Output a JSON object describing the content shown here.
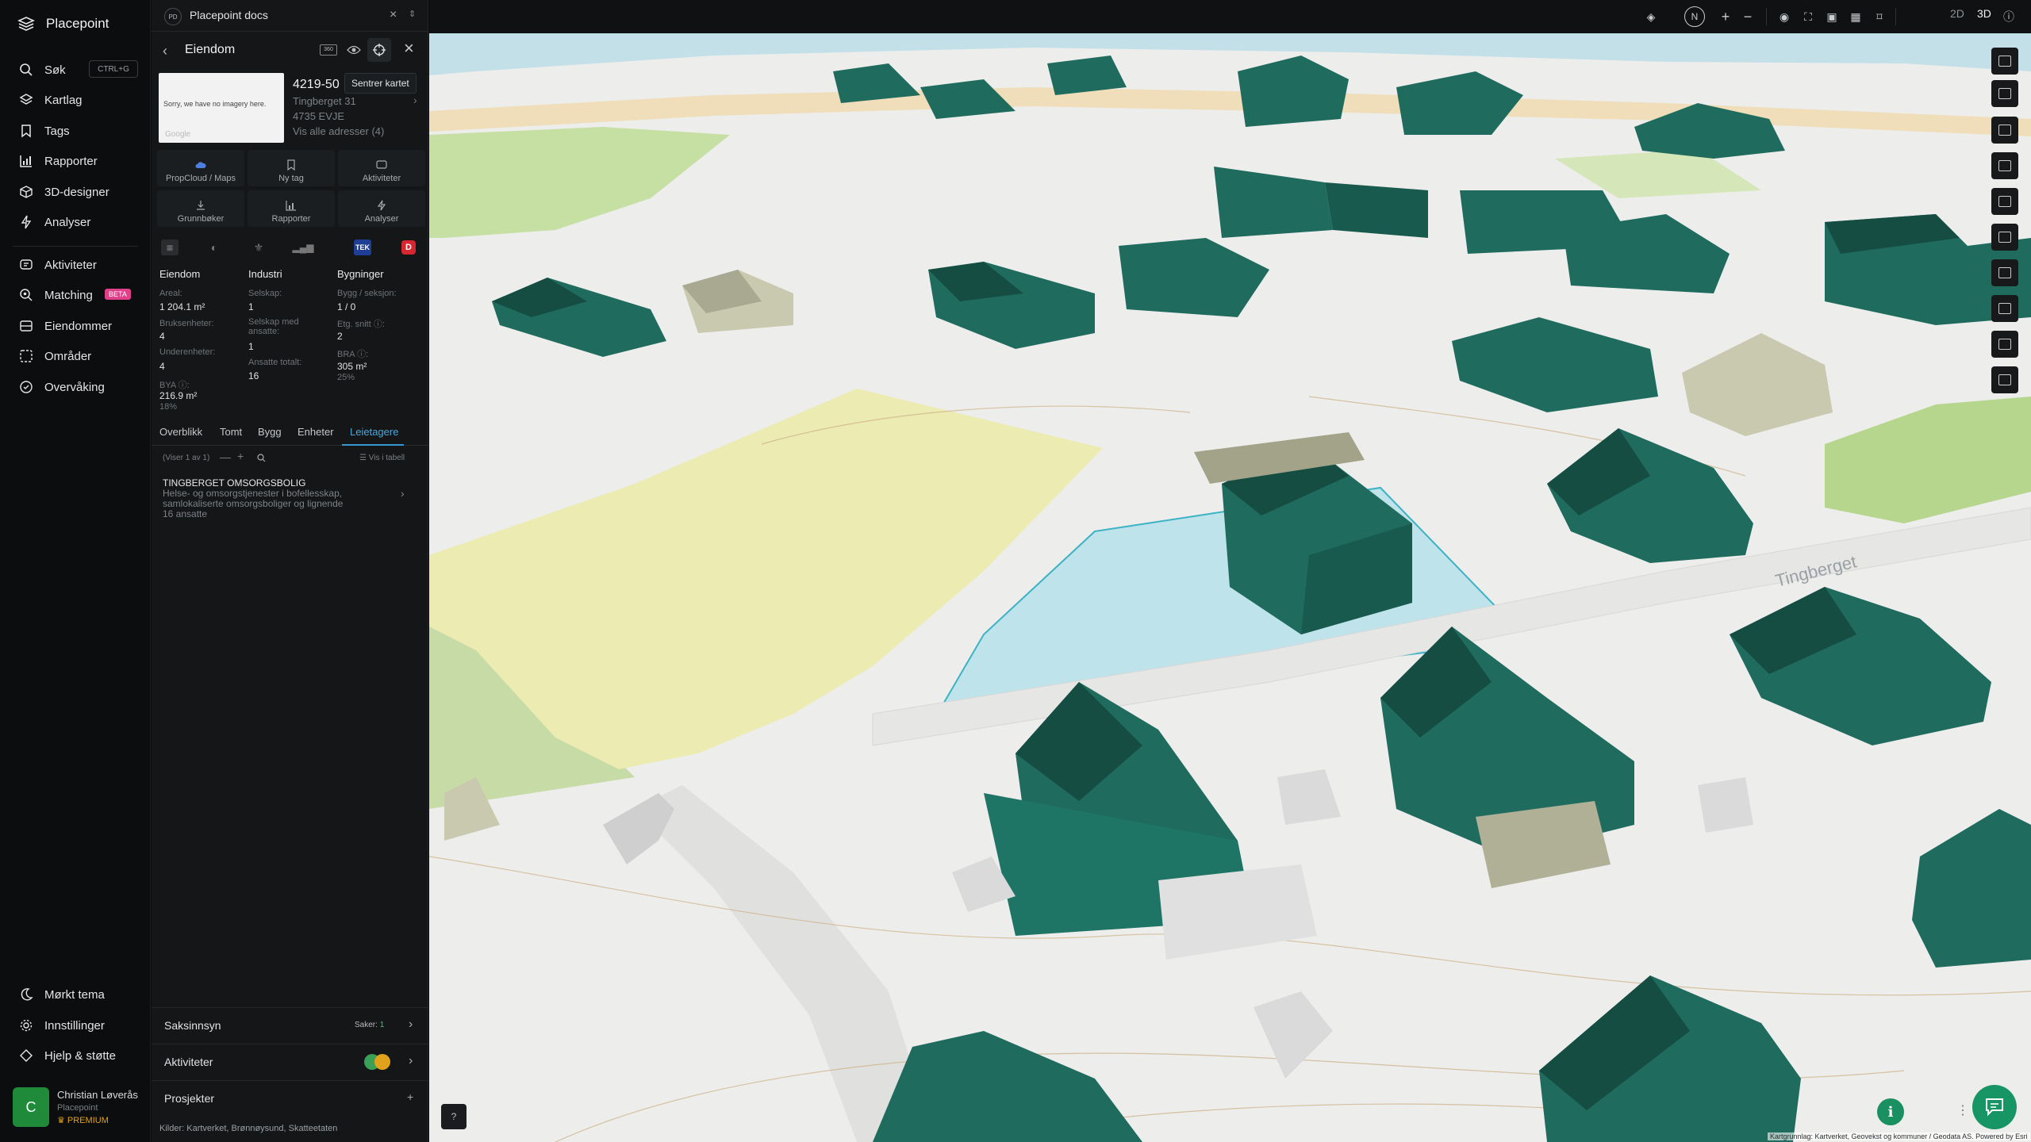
{
  "app": {
    "name": "Placepoint"
  },
  "nav": {
    "search": {
      "label": "Søk",
      "shortcut": "CTRL+G"
    },
    "items": [
      {
        "label": "Kartlag"
      },
      {
        "label": "Tags"
      },
      {
        "label": "Rapporter"
      },
      {
        "label": "3D-designer"
      },
      {
        "label": "Analyser"
      }
    ],
    "items2": [
      {
        "label": "Aktiviteter"
      },
      {
        "label": "Matching",
        "badge": "BETA"
      },
      {
        "label": "Eiendommer"
      },
      {
        "label": "Områder"
      },
      {
        "label": "Overvåking"
      }
    ],
    "bottom": [
      {
        "label": "Mørkt tema"
      },
      {
        "label": "Innstillinger"
      },
      {
        "label": "Hjelp & støtte"
      }
    ],
    "user": {
      "initial": "C",
      "name": "Christian Løverås",
      "org": "Placepoint",
      "plan": "PREMIUM"
    }
  },
  "panel": {
    "doc": {
      "badge": "PD",
      "title": "Placepoint docs"
    },
    "title": "Eiendom",
    "tooltip": "Sentrer kartet",
    "thumb": {
      "text": "Sorry, we have no imagery here.",
      "watermark": "Google"
    },
    "property": {
      "id": "4219-50",
      "address": "Tingberget 31",
      "postal": "4735 EVJE",
      "all_addresses": "Vis alle adresser (4)"
    },
    "actions": [
      "PropCloud / Maps",
      "Ny tag",
      "Aktiviteter",
      "Grunnbøker",
      "Rapporter",
      "Analyser"
    ],
    "ext_tiles": {
      "tek": "TEK",
      "d": "D"
    },
    "columns": {
      "eiendom": {
        "title": "Eiendom",
        "areal_l": "Areal:",
        "areal_v": "1 204.1 m²",
        "brukse_l": "Bruksenheter:",
        "brukse_v": "4",
        "under_l": "Underenheter:",
        "under_v": "4",
        "bya_l": "BYA ⓘ:",
        "bya_v": "216.9 m²",
        "bya_pct": "18%"
      },
      "industri": {
        "title": "Industri",
        "selskap_l": "Selskap:",
        "selskap_v": "1",
        "ansatte_l": "Selskap med ansatte:",
        "ansatte_v": "1",
        "total_l": "Ansatte totalt:",
        "total_v": "16"
      },
      "bygninger": {
        "title": "Bygninger",
        "seksjon_l": "Bygg / seksjon:",
        "seksjon_v": "1 / 0",
        "etg_l": "Etg. snitt ⓘ:",
        "etg_v": "2",
        "bra_l": "BRA ⓘ:",
        "bra_v": "305 m²",
        "bra_pct": "25%"
      }
    },
    "tabs": [
      "Overblikk",
      "Tomt",
      "Bygg",
      "Enheter",
      "Leietagere"
    ],
    "active_tab": "Leietagere",
    "list": {
      "count": "(Viser 1 av 1)",
      "table": "Vis i tabell"
    },
    "tenant": {
      "name": "TINGBERGET OMSORGSBOLIG",
      "desc1": "Helse- og omsorgstjenester i bofellesskap,",
      "desc2": "samlokaliserte omsorgsboliger og lignende",
      "employees": "16 ansatte"
    },
    "saksinnsyn": {
      "label": "Saksinnsyn",
      "cases_l": "Saker:",
      "cases_v": "1"
    },
    "aktiviteter": {
      "label": "Aktiviteter"
    },
    "prosjekter": {
      "label": "Prosjekter",
      "add": "+"
    },
    "kilder": {
      "label": "Kilder:",
      "items": "Kartverket, Brønnøysund, Skatteetaten"
    }
  },
  "topbar": {
    "north": "N",
    "mode_2d": "2D",
    "mode_3d": "3D",
    "active_mode": "3D"
  },
  "map": {
    "street": "Tingberget",
    "attribution": "Kartgrunnlag: Kartverket, Geovekst og kommuner / Geodata AS. Powered by Esri",
    "colors": {
      "building": "#1f6b5e",
      "building_dark": "#154d43",
      "roof": "#195a4f",
      "selected_plot": "#bfe3ea",
      "zone_yellow": "#ecebb2",
      "zone_green": "#c6dfa3",
      "road": "#f0ddb9"
    }
  }
}
